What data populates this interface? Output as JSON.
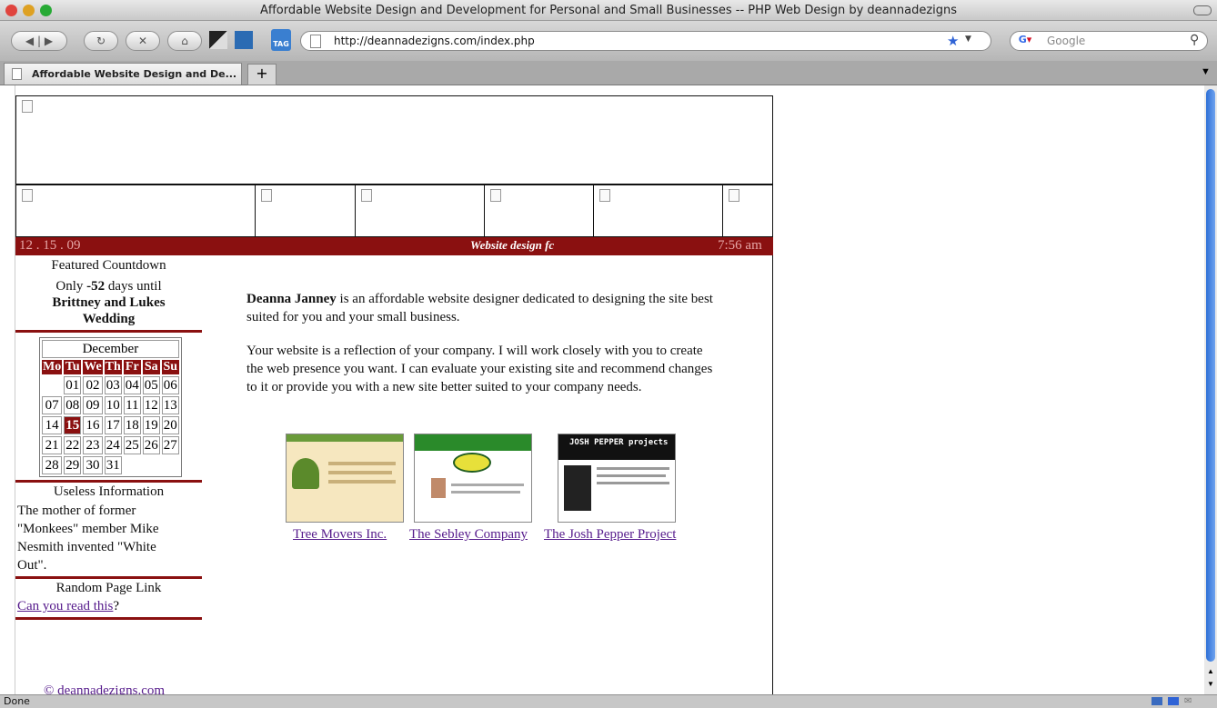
{
  "window": {
    "title": "Affordable Website Design and Development for Personal and Small Businesses -- PHP Web Design by deannadezigns"
  },
  "toolbar": {
    "url": "http://deannadezigns.com/index.php",
    "search_placeholder": "Google"
  },
  "tab": {
    "label": "Affordable Website Design and De...",
    "new_tab": "+"
  },
  "status": {
    "text": "Done"
  },
  "page": {
    "date": "12 . 15 . 09",
    "ticker": "Website design fc",
    "time": "7:56 am",
    "countdown": {
      "heading": "Featured Countdown",
      "prefix": "Only",
      "days": "-52",
      "suffix": "days until",
      "event": "Brittney and Lukes Wedding"
    },
    "calendar": {
      "month": "December",
      "weekdays": [
        "Mo",
        "Tu",
        "We",
        "Th",
        "Fr",
        "Sa",
        "Su"
      ],
      "weeks": [
        [
          "",
          "01",
          "02",
          "03",
          "04",
          "05",
          "06"
        ],
        [
          "07",
          "08",
          "09",
          "10",
          "11",
          "12",
          "13"
        ],
        [
          "14",
          "15",
          "16",
          "17",
          "18",
          "19",
          "20"
        ],
        [
          "21",
          "22",
          "23",
          "24",
          "25",
          "26",
          "27"
        ],
        [
          "28",
          "29",
          "30",
          "31",
          "",
          "",
          ""
        ]
      ],
      "today": "15"
    },
    "useless": {
      "heading": "Useless Information",
      "text": "The mother of former \"Monkees\" member Mike Nesmith invented \"White Out\"."
    },
    "random": {
      "heading": "Random Page Link",
      "link": "Can you read this",
      "suffix": "?"
    },
    "footer_link": "© deannadezigns.com",
    "intro": {
      "name": "Deanna Janney",
      "rest": " is an affordable website designer dedicated to designing the site best suited for you and your small business."
    },
    "para2": "Your website is a reflection of your company. I will work closely with you to create the web presence you want. I can evaluate your existing site and recommend changes to it or provide you with a new site better suited to your company needs.",
    "portfolio": [
      {
        "label": "Tree Movers Inc."
      },
      {
        "label": "The Sebley Company"
      },
      {
        "label": "The Josh Pepper Project"
      }
    ],
    "josh_thumb_text": "JOSH PEPPER projects"
  }
}
